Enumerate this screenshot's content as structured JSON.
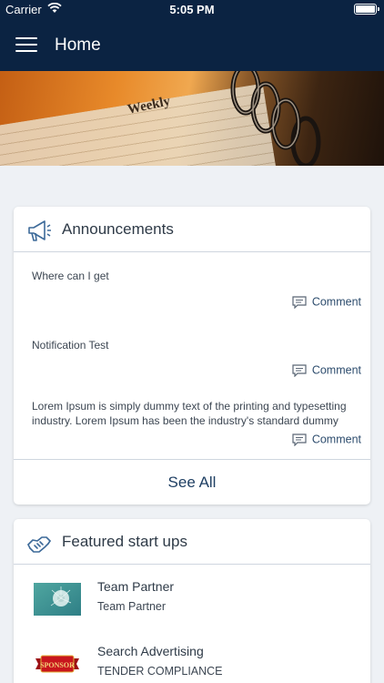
{
  "status_bar": {
    "carrier": "Carrier",
    "time": "5:05 PM"
  },
  "nav": {
    "title": "Home",
    "menu_icon": "hamburger-menu-icon"
  },
  "hero": {
    "banner_text": "Weekly"
  },
  "announcements": {
    "heading": "Announcements",
    "icon": "megaphone-icon",
    "items": [
      {
        "text": "Where can I get",
        "comment_label": "Comment"
      },
      {
        "text": "Notification Test",
        "comment_label": "Comment"
      },
      {
        "text": "Lorem Ipsum is simply dummy text of the printing and typesetting industry. Lorem Ipsum has been the industry's standard dummy text…",
        "comment_label": "Comment"
      }
    ],
    "see_all_label": "See All"
  },
  "featured": {
    "heading": "Featured start ups",
    "icon": "handshake-icon",
    "items": [
      {
        "name": "Team Partner",
        "subtitle": "Team Partner"
      },
      {
        "name": "Search Advertising",
        "subtitle": "TENDER COMPLIANCE",
        "badge_text": "SPONSOR"
      }
    ]
  },
  "colors": {
    "nav_background": "#0b2342",
    "page_background": "#eef1f5",
    "link": "#1f3f63"
  }
}
